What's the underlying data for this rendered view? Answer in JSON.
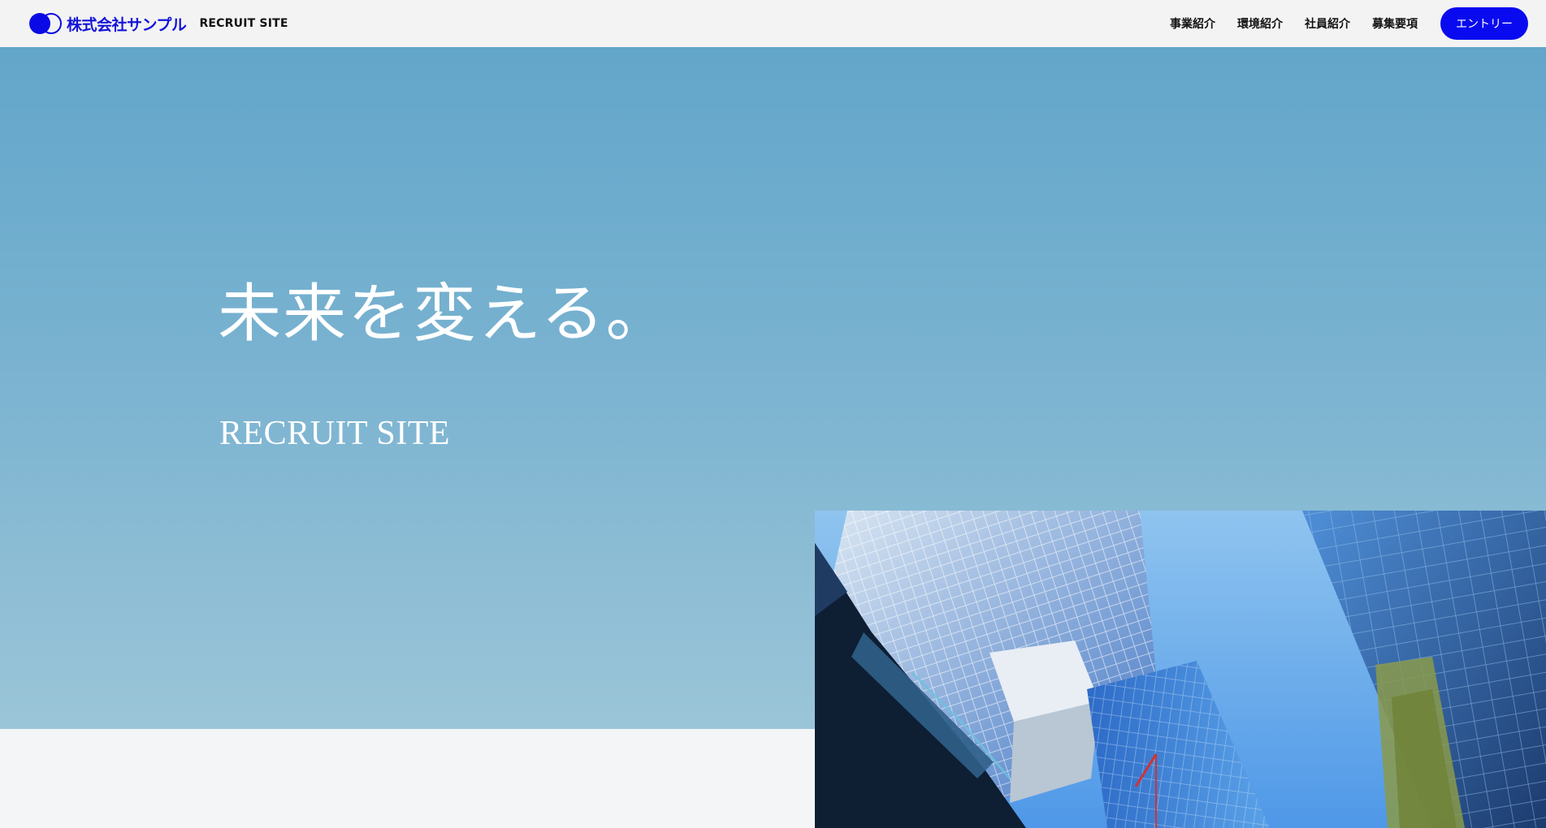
{
  "header": {
    "company_name": "株式会社サンプル",
    "site_label": "RECRUIT SITE",
    "nav": [
      {
        "label": "事業紹介"
      },
      {
        "label": "環境紹介"
      },
      {
        "label": "社員紹介"
      },
      {
        "label": "募集要項"
      }
    ],
    "entry_label": "エントリー"
  },
  "hero": {
    "title": "未来を変える。",
    "subtitle": "RECRUIT SITE"
  },
  "colors": {
    "brand_blue": "#0a0af0",
    "hero_gradient_top": "#62a6ca",
    "hero_gradient_bottom": "#9bc5d8",
    "header_bg": "#f3f3f3"
  },
  "icons": {
    "logo": "double-circle-logo-icon"
  }
}
